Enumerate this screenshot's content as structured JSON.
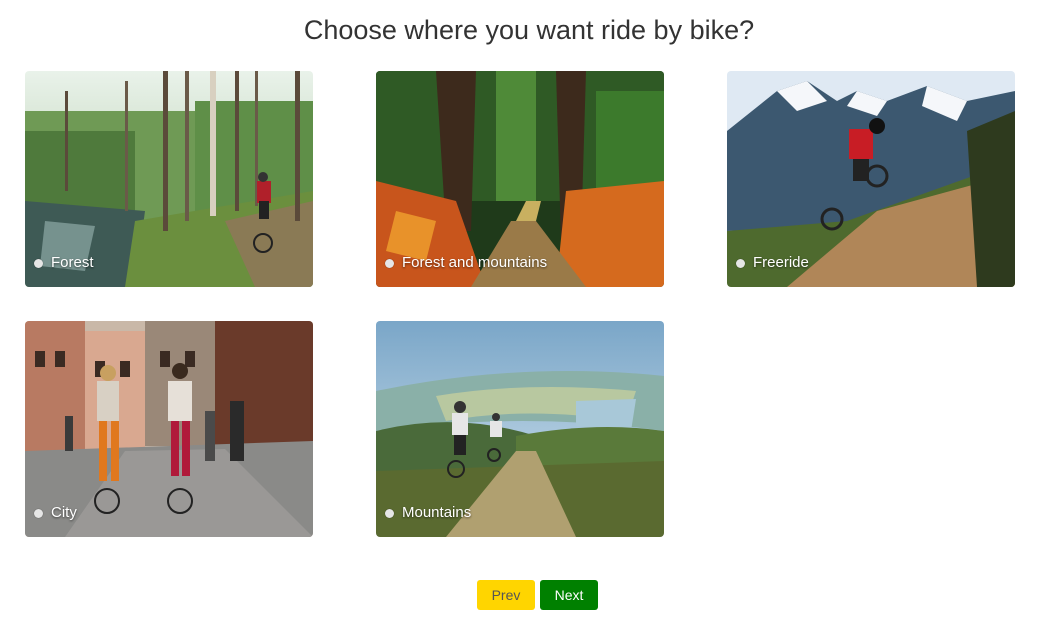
{
  "page": {
    "title": "Choose where you want ride by bike?"
  },
  "options": [
    {
      "label": "Forest",
      "image": "forest-path-cyclist-photo"
    },
    {
      "label": "Forest and mountains",
      "image": "forest-trail-autumn-photo"
    },
    {
      "label": "Freeride",
      "image": "mountain-freeride-jump-photo"
    },
    {
      "label": "City",
      "image": "city-street-cyclists-photo"
    },
    {
      "label": "Mountains",
      "image": "mountain-road-cyclists-photo"
    }
  ],
  "navigation": {
    "prev_label": "Prev",
    "next_label": "Next"
  },
  "colors": {
    "prev_button": "#ffd500",
    "next_button": "#008000",
    "title_text": "#333333"
  }
}
